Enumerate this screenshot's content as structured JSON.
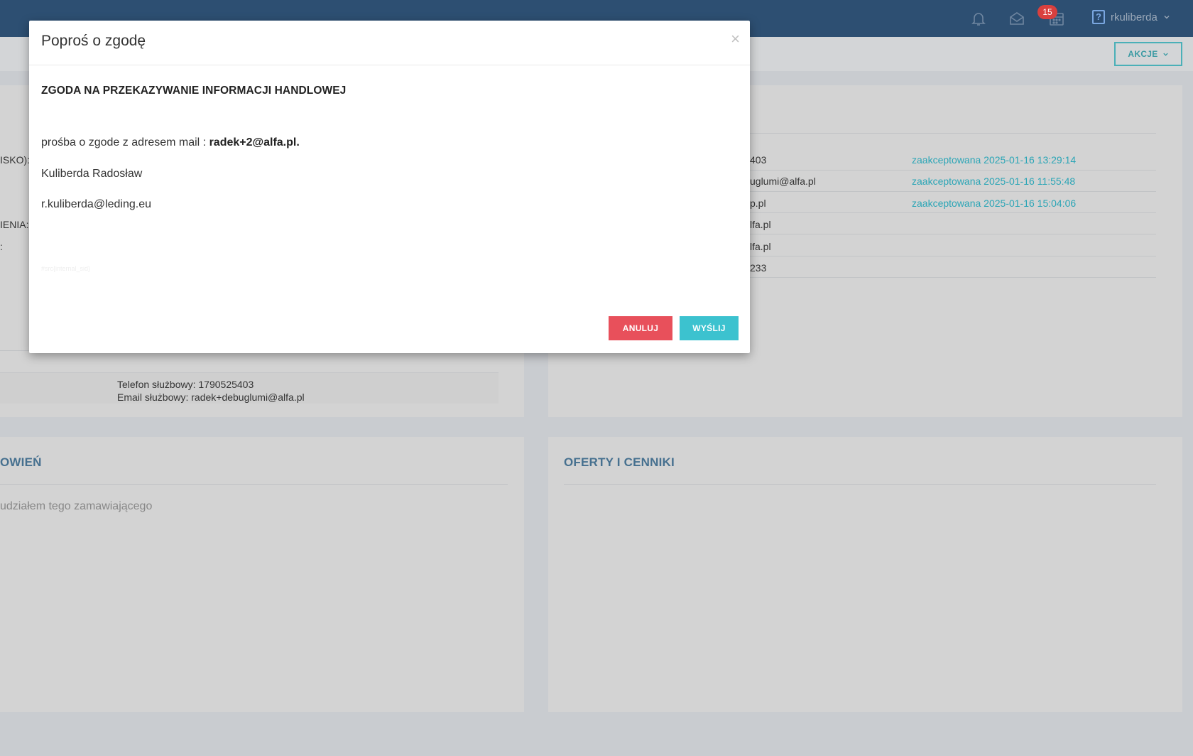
{
  "topbar": {
    "notification_count": "15",
    "username": "rkuliberda",
    "help_glyph": "?"
  },
  "toolbar": {
    "actions_label": "AKCJE"
  },
  "left_panel": {
    "field_labels": [
      "ISKO):",
      "IENIA:",
      ":"
    ],
    "contact_phone": "Telefon służbowy: 1790525403",
    "contact_email": "Email służbowy: radek+debuglumi@alfa.pl"
  },
  "right_panel": {
    "rows": [
      {
        "value": "403",
        "status": "zaakceptowana 2025-01-16 13:29:14"
      },
      {
        "value": "uglumi@alfa.pl",
        "status": "zaakceptowana 2025-01-16 11:55:48"
      },
      {
        "value": "p.pl",
        "status": "zaakceptowana 2025-01-16 15:04:06"
      },
      {
        "value": "lfa.pl",
        "status": ""
      },
      {
        "value": "lfa.pl",
        "status": ""
      },
      {
        "value": "233",
        "status": ""
      }
    ]
  },
  "orders_panel": {
    "title": "OWIEŃ",
    "empty_text": "udziałem tego zamawiającego"
  },
  "offers_panel": {
    "title": "OFERTY I CENNIKI"
  },
  "modal": {
    "title": "Poproś o zgodę",
    "close_glyph": "×",
    "consent_title": "ZGODA NA PRZEKAZYWANIE INFORMACJI HANDLOWEJ",
    "request_prefix": "prośba o zgode z adresem mail : ",
    "request_email": "radek+2@alfa.pl.",
    "name": "Kuliberda Radosław",
    "sender_email": "r.kuliberda@leding.eu",
    "hidden_tag": "#src{internal_sid}",
    "cancel_label": "ANULUJ",
    "send_label": "WYŚLIJ"
  },
  "colors": {
    "topbar": "#2d4f72",
    "accent": "#3cc2cf",
    "danger": "#e8505b",
    "link": "#2aa5b6",
    "badge": "#d9403e"
  }
}
